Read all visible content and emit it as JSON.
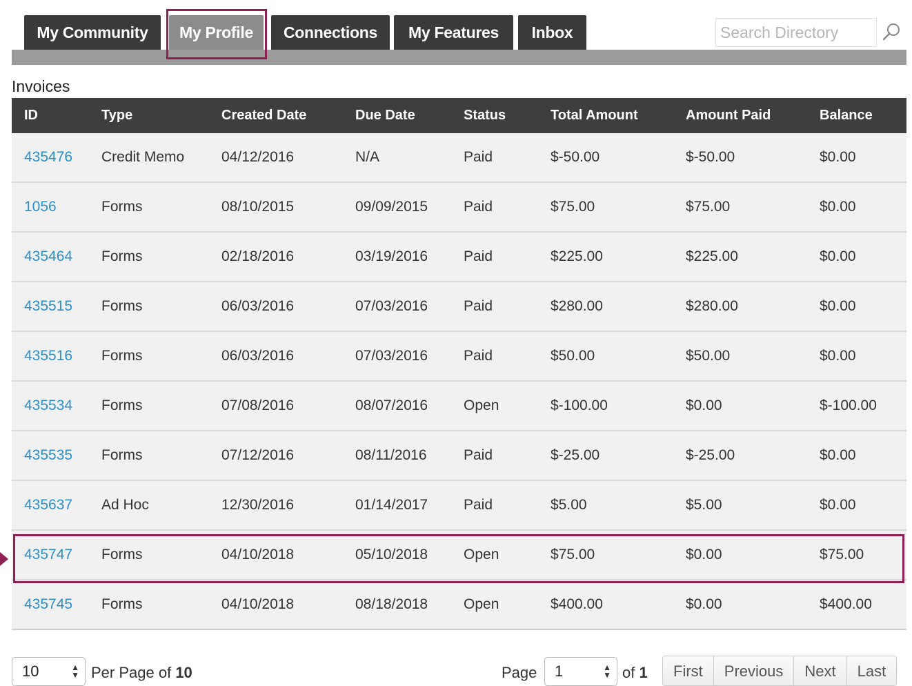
{
  "nav": {
    "tabs": [
      {
        "label": "My Community"
      },
      {
        "label": "My Profile"
      },
      {
        "label": "Connections"
      },
      {
        "label": "My Features"
      },
      {
        "label": "Inbox"
      }
    ],
    "active_tab": "My Profile",
    "search_placeholder": "Search Directory",
    "search_icon": "search-icon"
  },
  "invoices": {
    "title": "Invoices",
    "columns": [
      "ID",
      "Type",
      "Created Date",
      "Due Date",
      "Status",
      "Total Amount",
      "Amount Paid",
      "Balance"
    ],
    "rows": [
      [
        "435476",
        "Credit Memo",
        "04/12/2016",
        "N/A",
        "Paid",
        "$-50.00",
        "$-50.00",
        "$0.00"
      ],
      [
        "1056",
        "Forms",
        "08/10/2015",
        "09/09/2015",
        "Paid",
        "$75.00",
        "$75.00",
        "$0.00"
      ],
      [
        "435464",
        "Forms",
        "02/18/2016",
        "03/19/2016",
        "Paid",
        "$225.00",
        "$225.00",
        "$0.00"
      ],
      [
        "435515",
        "Forms",
        "06/03/2016",
        "07/03/2016",
        "Paid",
        "$280.00",
        "$280.00",
        "$0.00"
      ],
      [
        "435516",
        "Forms",
        "06/03/2016",
        "07/03/2016",
        "Paid",
        "$50.00",
        "$50.00",
        "$0.00"
      ],
      [
        "435534",
        "Forms",
        "07/08/2016",
        "08/07/2016",
        "Open",
        "$-100.00",
        "$0.00",
        "$-100.00"
      ],
      [
        "435535",
        "Forms",
        "07/12/2016",
        "08/11/2016",
        "Paid",
        "$-25.00",
        "$-25.00",
        "$0.00"
      ],
      [
        "435637",
        "Ad Hoc",
        "12/30/2016",
        "01/14/2017",
        "Paid",
        "$5.00",
        "$5.00",
        "$0.00"
      ],
      [
        "435747",
        "Forms",
        "04/10/2018",
        "05/10/2018",
        "Open",
        "$75.00",
        "$0.00",
        "$75.00"
      ],
      [
        "435745",
        "Forms",
        "04/10/2018",
        "08/18/2018",
        "Open",
        "$400.00",
        "$0.00",
        "$400.00"
      ]
    ],
    "link_color": "#2a8fc9",
    "highlight_color": "#8e2054"
  },
  "pager": {
    "per_page_value": "10",
    "per_page_label": "Per Page of",
    "total": "10",
    "page_label": "Page",
    "page_value": "1",
    "of_label": "of",
    "page_total": "1",
    "buttons": [
      "First",
      "Previous",
      "Next",
      "Last"
    ]
  }
}
